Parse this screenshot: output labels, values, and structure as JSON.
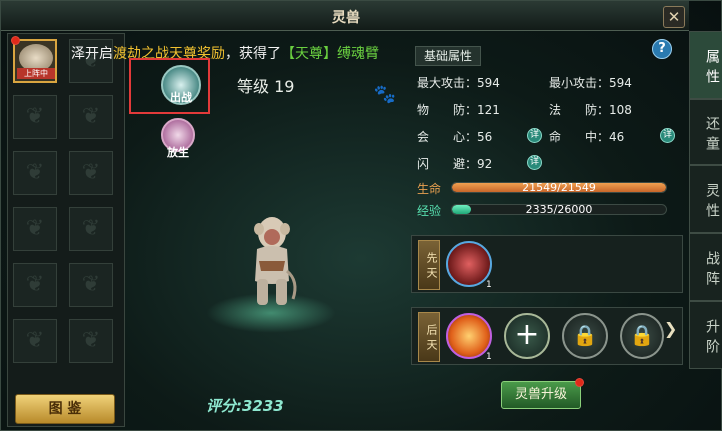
{
  "window": {
    "title": "灵兽",
    "close_symbol": "✕"
  },
  "right_tabs": [
    {
      "label": "属性",
      "active": true
    },
    {
      "label": "还童",
      "active": false
    },
    {
      "label": "灵性",
      "active": false
    },
    {
      "label": "战阵",
      "active": false
    },
    {
      "label": "升阶",
      "active": false
    }
  ],
  "left": {
    "active_pet_badge": "上阵中",
    "empty_slot_glyph": "❦",
    "catalog_button": "图 鉴"
  },
  "marquee": {
    "part1": "泽开启",
    "part2": "渡劫之战天尊奖励",
    "part3": "，获得了",
    "part4": "【天尊】缚魂臂"
  },
  "pet_actions": {
    "deploy": "出战",
    "release": "放生"
  },
  "pet": {
    "level_text": "等级 19",
    "score_text": "评分:3233",
    "paw_icon": "paw-icon"
  },
  "info": {
    "tab_label": "基础属性",
    "help": "?",
    "stats": {
      "max_attack": "最大攻击：594",
      "min_attack": "最小攻击：594",
      "phys_def": "物　　防：121",
      "magic_def": "法　　防：108",
      "crit": "会　　心：56",
      "hit": "命　　中：46",
      "dodge": "闪　　避：92"
    },
    "detail_icon": "详",
    "hp_label": "生命",
    "hp_text": "21549/21549",
    "hp_current": 21549,
    "hp_max": 21549,
    "exp_label": "经验",
    "exp_text": "2335/26000",
    "exp_current": 2335,
    "exp_max": 26000
  },
  "skills": {
    "innate_label": "先天",
    "acquired_label": "后天",
    "innate_level": "1",
    "acquired_level": "1",
    "add_symbol": "+",
    "lock_symbol": "🔒",
    "more_symbol": "❯"
  },
  "upgrade_button": "灵兽升级",
  "colors": {
    "hp": "#e08a3a",
    "exp": "#3ad8a0",
    "accent": "#d9a540",
    "highlight": "#e23a3a"
  }
}
